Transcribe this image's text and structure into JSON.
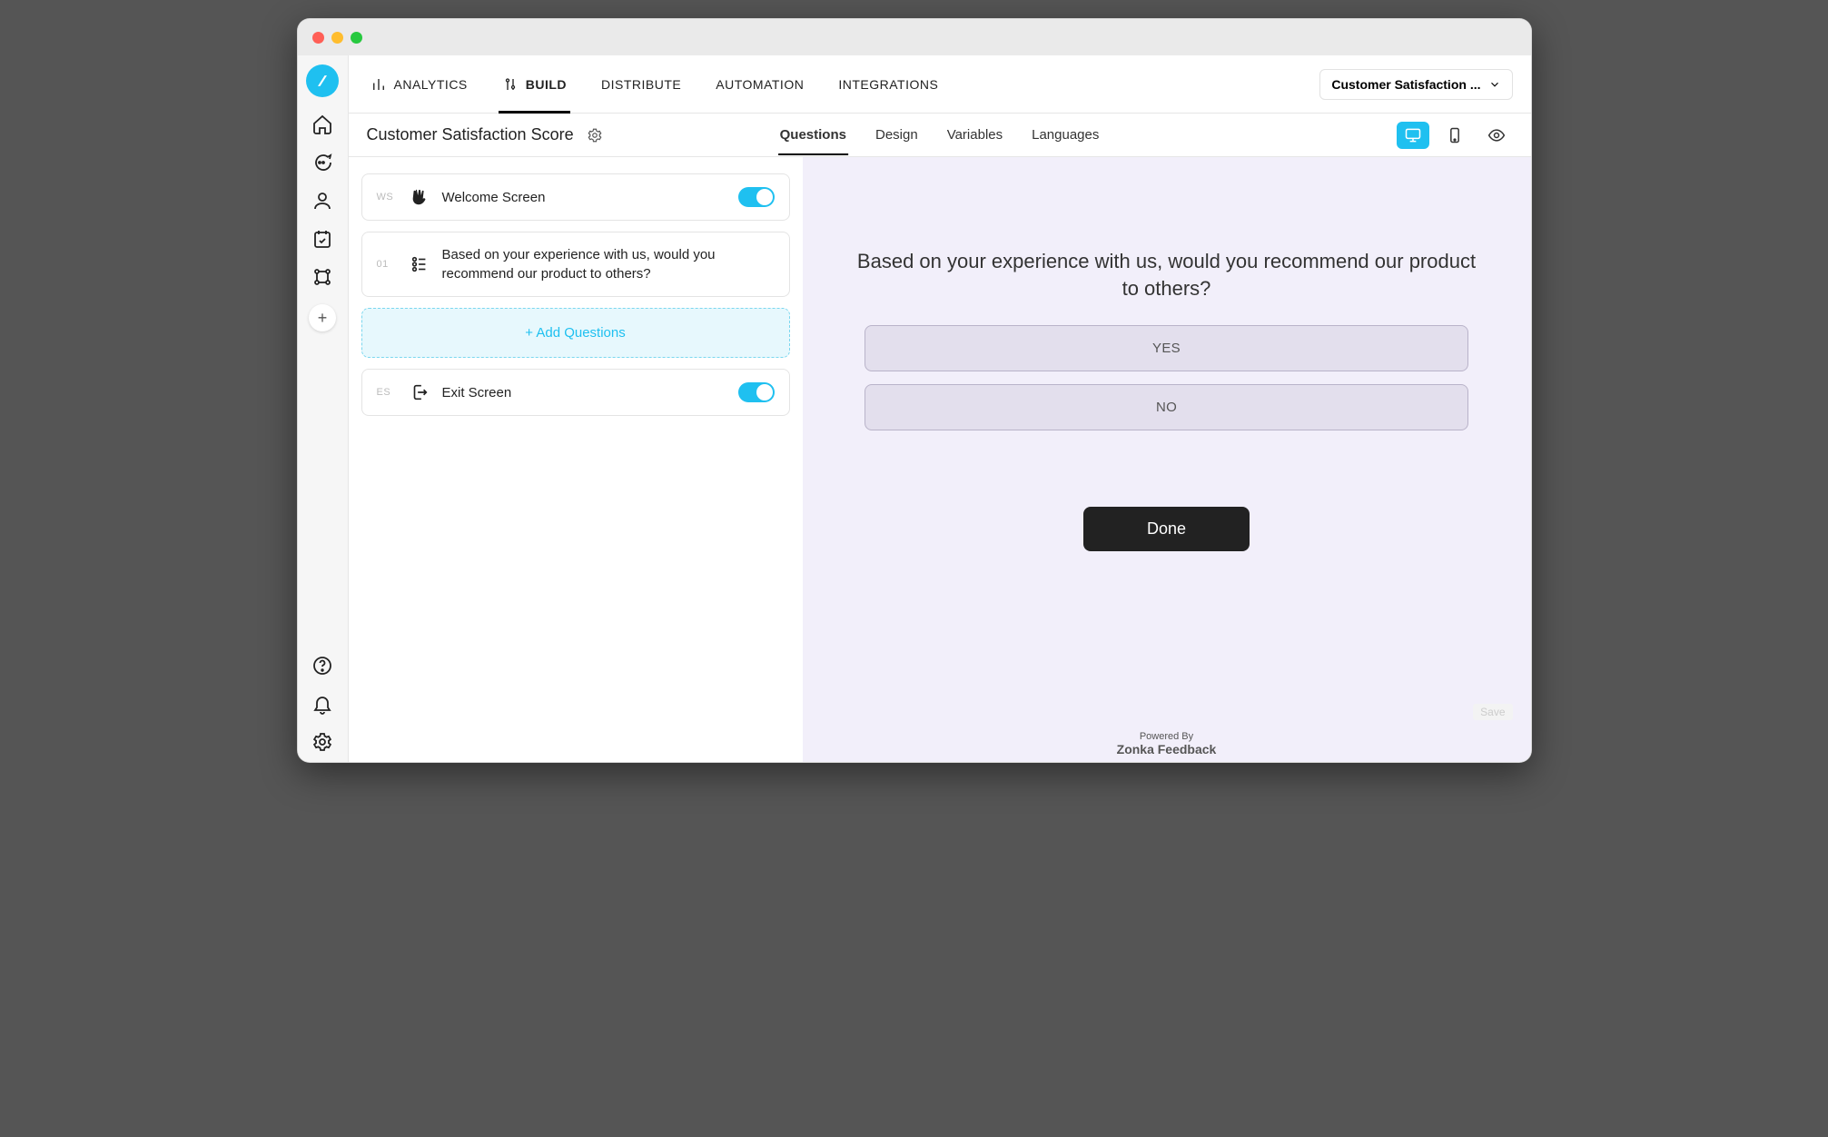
{
  "topnav": {
    "items": [
      {
        "label": "ANALYTICS"
      },
      {
        "label": "BUILD"
      },
      {
        "label": "DISTRIBUTE"
      },
      {
        "label": "AUTOMATION"
      },
      {
        "label": "INTEGRATIONS"
      }
    ],
    "dropdown_label": "Customer Satisfaction ..."
  },
  "subheader": {
    "title": "Customer Satisfaction Score",
    "tabs": [
      {
        "label": "Questions"
      },
      {
        "label": "Design"
      },
      {
        "label": "Variables"
      },
      {
        "label": "Languages"
      }
    ]
  },
  "question_list": {
    "welcome": {
      "badge": "WS",
      "label": "Welcome Screen"
    },
    "q1": {
      "badge": "01",
      "text": "Based on your experience with us, would you recommend our product to others?"
    },
    "add_label": "+ Add Questions",
    "exit": {
      "badge": "ES",
      "label": "Exit Screen"
    }
  },
  "preview": {
    "question": "Based on your experience with us, would you recommend our product to others?",
    "option_yes": "YES",
    "option_no": "NO",
    "done_label": "Done",
    "save_label": "Save",
    "powered_by_small": "Powered By",
    "powered_by_brand": "Zonka Feedback"
  }
}
